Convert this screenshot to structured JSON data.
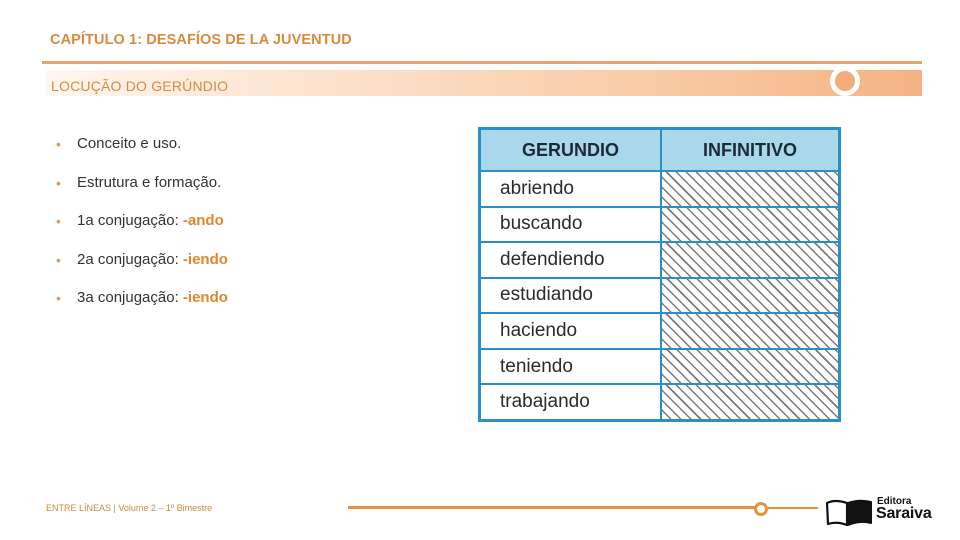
{
  "header": {
    "chapter_title": "CAPÍTULO 1: DESAFÍOS DE LA JUVENTUD",
    "section_title": "LOCUÇÃO DO GERÚNDIO"
  },
  "bullets": [
    {
      "text": "Conceito e uso.",
      "suffix": ""
    },
    {
      "text": "Estrutura e formação.",
      "suffix": ""
    },
    {
      "text": "1a conjugação: ",
      "suffix": "-ando"
    },
    {
      "text": "2a conjugação: ",
      "suffix": "-iendo"
    },
    {
      "text": "3a conjugação: ",
      "suffix": "-iendo"
    }
  ],
  "table": {
    "headers": [
      "GERUNDIO",
      "INFINITIVO"
    ],
    "rows": [
      {
        "gerundio": "abriendo",
        "infinitivo": ""
      },
      {
        "gerundio": "buscando",
        "infinitivo": ""
      },
      {
        "gerundio": "defendiendo",
        "infinitivo": ""
      },
      {
        "gerundio": "estudiando",
        "infinitivo": ""
      },
      {
        "gerundio": "haciendo",
        "infinitivo": ""
      },
      {
        "gerundio": "teniendo",
        "infinitivo": ""
      },
      {
        "gerundio": "trabajando",
        "infinitivo": ""
      }
    ]
  },
  "footer": {
    "text": "ENTRE LÍNEAS  | Volume 2 – 1º Bimestre",
    "logo_small": "Editora",
    "logo_big": "Saraiva"
  },
  "colors": {
    "accent_orange": "#d98a3e",
    "table_border": "#2a8ec7",
    "table_header_bg": "#a8d8ea"
  }
}
